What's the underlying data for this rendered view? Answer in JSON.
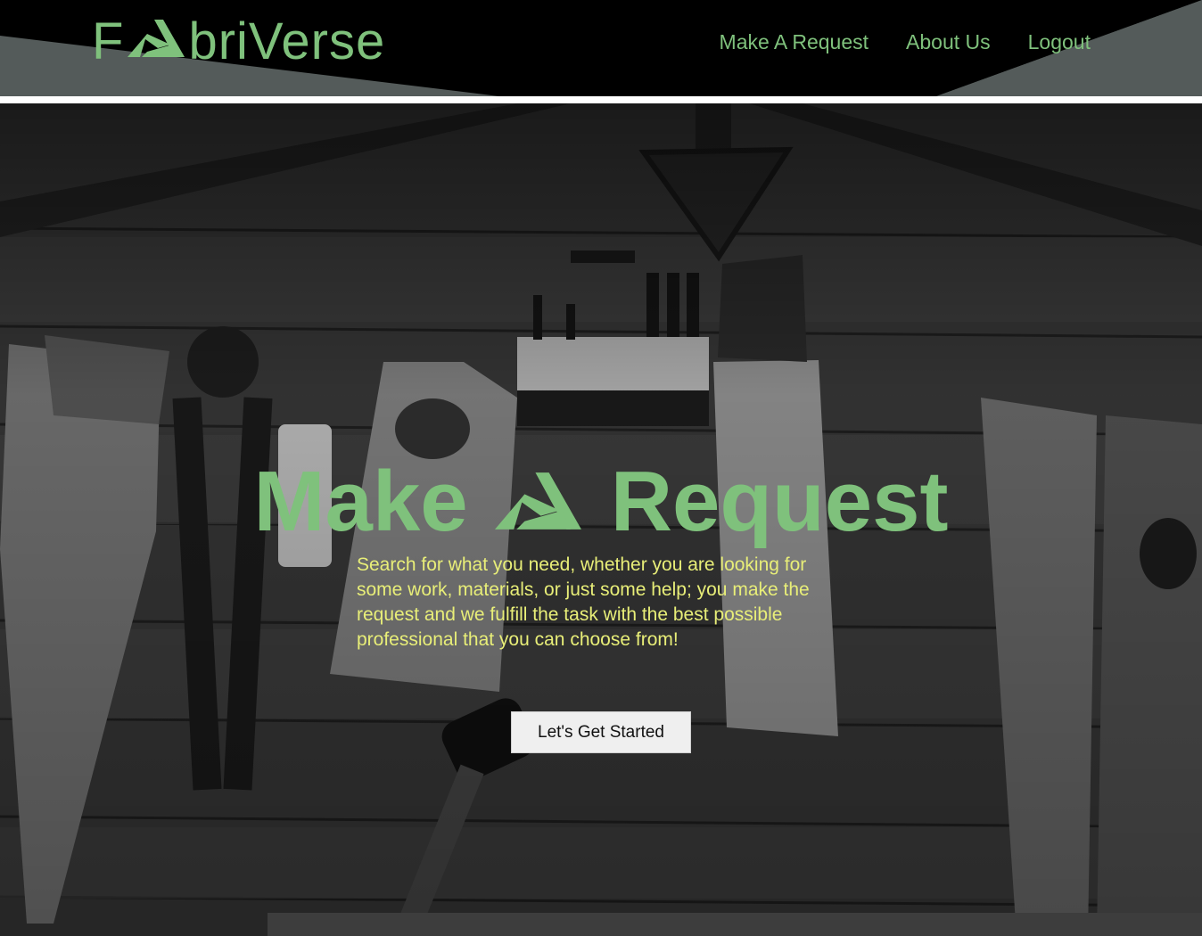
{
  "header": {
    "logo": {
      "before": "F",
      "after": "briVerse",
      "icon": "fabriverse-a-logo-icon"
    },
    "nav": [
      "Make A Request",
      "About Us",
      "Logout"
    ]
  },
  "hero": {
    "background": "workshop-tools-wall-photo",
    "title_left": "Make",
    "title_right": "Request",
    "title_icon": "fabriverse-a-logo-icon",
    "description": "Search for what you need, whether you are looking for some work, materials, or just some help; you make the request and we fulfill the task with the best possible professional that you can choose from!",
    "cta_label": "Let's Get Started"
  },
  "colors": {
    "brand_green": "#7fc17c",
    "description_yellow": "#e8ee78",
    "header_gray": "#545b5a",
    "header_black": "#000000"
  }
}
